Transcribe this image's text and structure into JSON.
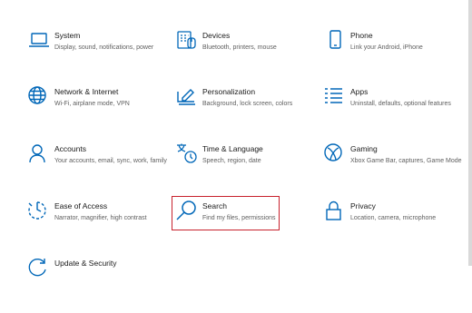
{
  "accent_color": "#0067b8",
  "tiles": [
    {
      "title": "System",
      "desc": "Display, sound, notifications, power",
      "icon": "laptop-icon"
    },
    {
      "title": "Devices",
      "desc": "Bluetooth, printers, mouse",
      "icon": "keyboard-icon"
    },
    {
      "title": "Phone",
      "desc": "Link your Android, iPhone",
      "icon": "phone-icon"
    },
    {
      "title": "Network & Internet",
      "desc": "Wi-Fi, airplane mode, VPN",
      "icon": "globe-icon"
    },
    {
      "title": "Personalization",
      "desc": "Background, lock screen, colors",
      "icon": "pen-tablet-icon"
    },
    {
      "title": "Apps",
      "desc": "Uninstall, defaults, optional features",
      "icon": "apps-list-icon"
    },
    {
      "title": "Accounts",
      "desc": "Your accounts, email, sync, work, family",
      "icon": "person-icon"
    },
    {
      "title": "Time & Language",
      "desc": "Speech, region, date",
      "icon": "time-language-icon"
    },
    {
      "title": "Gaming",
      "desc": "Xbox Game Bar, captures, Game Mode",
      "icon": "xbox-icon"
    },
    {
      "title": "Ease of Access",
      "desc": "Narrator, magnifier, high contrast",
      "icon": "ease-of-access-icon"
    },
    {
      "title": "Search",
      "desc": "Find my files, permissions",
      "icon": "search-icon"
    },
    {
      "title": "Privacy",
      "desc": "Location, camera, microphone",
      "icon": "lock-icon"
    },
    {
      "title": "Update & Security",
      "desc": "",
      "icon": "update-icon"
    }
  ],
  "selected_tile": "Search"
}
